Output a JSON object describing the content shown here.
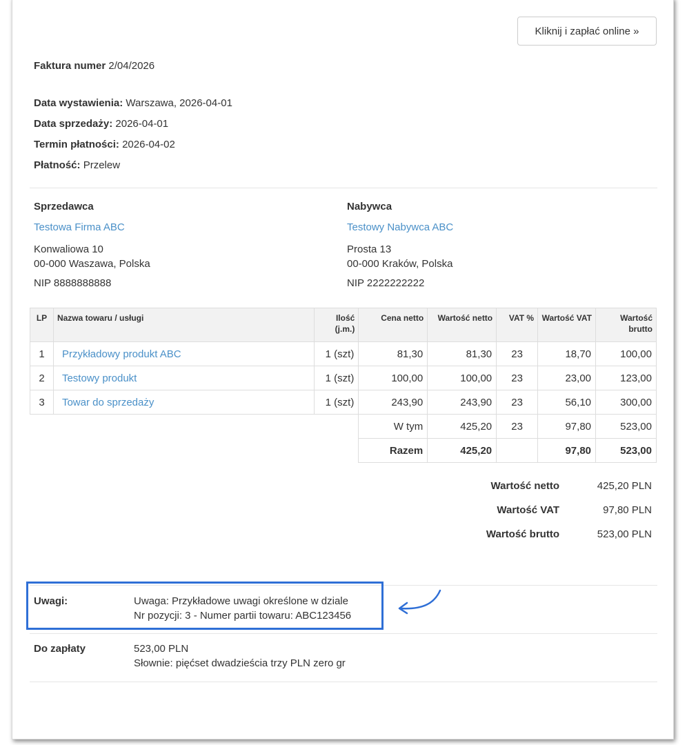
{
  "pay_button": "Kliknij i zapłać online »",
  "invoice": {
    "title_label": "Faktura numer",
    "number": "2/04/2026"
  },
  "meta": [
    {
      "label": "Data wystawienia:",
      "value": "Warszawa, 2026-04-01"
    },
    {
      "label": "Data sprzedaży:",
      "value": "2026-04-01"
    },
    {
      "label": "Termin płatności:",
      "value": "2026-04-02"
    },
    {
      "label": "Płatność:",
      "value": "Przelew"
    }
  ],
  "seller": {
    "heading": "Sprzedawca",
    "name": "Testowa Firma ABC",
    "street": "Konwaliowa 10",
    "city": "00-000 Waszawa, Polska",
    "nip": "NIP 8888888888"
  },
  "buyer": {
    "heading": "Nabywca",
    "name": "Testowy Nabywca ABC",
    "street": "Prosta 13",
    "city": "00-000 Kraków, Polska",
    "nip": "NIP 2222222222"
  },
  "table": {
    "headers": [
      "LP",
      "Nazwa towaru / usługi",
      "Ilość (j.m.)",
      "Cena netto",
      "Wartość netto",
      "VAT %",
      "Wartość VAT",
      "Wartość brutto"
    ],
    "rows": [
      {
        "lp": "1",
        "name": "Przykładowy produkt ABC",
        "qty": "1 (szt)",
        "price": "81,30",
        "net": "81,30",
        "vat_rate": "23",
        "vat": "18,70",
        "gross": "100,00"
      },
      {
        "lp": "2",
        "name": "Testowy produkt",
        "qty": "1 (szt)",
        "price": "100,00",
        "net": "100,00",
        "vat_rate": "23",
        "vat": "23,00",
        "gross": "123,00"
      },
      {
        "lp": "3",
        "name": "Towar do sprzedaży",
        "qty": "1 (szt)",
        "price": "243,90",
        "net": "243,90",
        "vat_rate": "23",
        "vat": "56,10",
        "gross": "300,00"
      }
    ],
    "subtotal": {
      "label": "W tym",
      "net": "425,20",
      "vat_rate": "23",
      "vat": "97,80",
      "gross": "523,00"
    },
    "total": {
      "label": "Razem",
      "net": "425,20",
      "vat_rate": "",
      "vat": "97,80",
      "gross": "523,00"
    }
  },
  "summary": [
    {
      "label": "Wartość netto",
      "value": "425,20 PLN"
    },
    {
      "label": "Wartość VAT",
      "value": "97,80 PLN"
    },
    {
      "label": "Wartość brutto",
      "value": "523,00 PLN"
    }
  ],
  "notes": {
    "label": "Uwagi:",
    "line1": "Uwaga: Przykładowe uwagi określone w dziale",
    "line2": "Nr pozycji: 3 - Numer partii towaru: ABC123456"
  },
  "payment_due": {
    "label": "Do zapłaty",
    "amount": "523,00 PLN",
    "words": "Słownie: pięćset dwadzieścia trzy PLN zero gr"
  },
  "colors": {
    "link": "#4a90c8",
    "highlight": "#2f6fd6"
  }
}
